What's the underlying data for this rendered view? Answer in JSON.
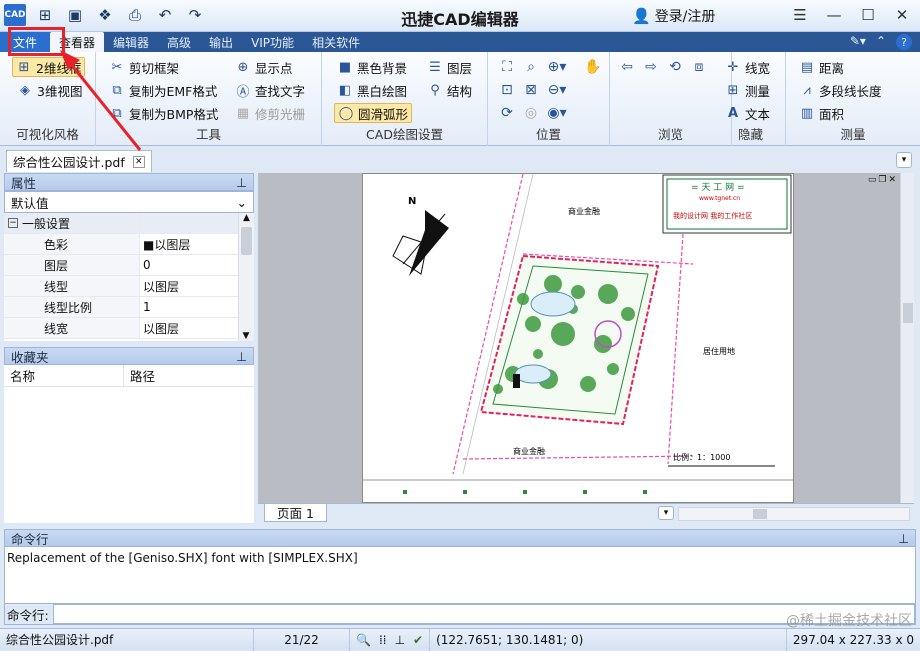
{
  "app": {
    "title": "迅捷CAD编辑器",
    "login": "登录/注册",
    "logo": "CAD"
  },
  "menu_tabs": [
    "文件",
    "查看器",
    "编辑器",
    "高级",
    "输出",
    "VIP功能",
    "相关软件"
  ],
  "ribbon": {
    "visual_style": {
      "label": "可视化风格",
      "btn_2d": "2维线框",
      "btn_3d": "3维视图"
    },
    "tools": {
      "label": "工具",
      "clip_frame": "剪切框架",
      "copy_emf": "复制为EMF格式",
      "copy_bmp": "复制为BMP格式",
      "show_point": "显示点",
      "find_text": "查找文字",
      "trim_raster": "修剪光栅"
    },
    "cad_settings": {
      "label": "CAD绘图设置",
      "black_bg": "黑色背景",
      "bw_draw": "黑白绘图",
      "smooth_arc": "圆滑弧形",
      "layers": "图层",
      "structure": "结构"
    },
    "position": {
      "label": "位置"
    },
    "browse": {
      "label": "浏览"
    },
    "hide": {
      "label": "隐藏",
      "line_width": "线宽",
      "measure": "测量",
      "text": "文本"
    },
    "measure": {
      "label": "测量",
      "distance": "距离",
      "polyline_length": "多段线长度",
      "area": "面积"
    }
  },
  "document_tab": "综合性公园设计.pdf",
  "properties": {
    "title": "属性",
    "selector": "默认值",
    "group": "一般设置",
    "rows": [
      {
        "key": "色彩",
        "value": "■以图层"
      },
      {
        "key": "图层",
        "value": "0"
      },
      {
        "key": "线型",
        "value": "以图层"
      },
      {
        "key": "线型比例",
        "value": "1"
      },
      {
        "key": "线宽",
        "value": "以图层"
      }
    ]
  },
  "favorites": {
    "title": "收藏夹",
    "col_name": "名称",
    "col_path": "路径"
  },
  "drawing": {
    "north": "N",
    "commercial": "商业金融",
    "residential": "居住用地",
    "scale": "比例：1：1000",
    "logo_line1": "= 天 工 网 =",
    "logo_line2": "www.tgnet.cn",
    "logo_line3": "我的设计网 我的工作社区"
  },
  "page_tab": "页面 1",
  "command": {
    "title": "命令行",
    "log": "Replacement of the [Geniso.SHX] font with [SIMPLEX.SHX]",
    "prompt": "命令行:",
    "input_value": ""
  },
  "status": {
    "file": "综合性公园设计.pdf",
    "page": "21/22",
    "coords": "(122.7651; 130.1481; 0)",
    "size": "297.04 x 227.33 x 0"
  },
  "watermark": "@稀土掘金技术社区",
  "colors": {
    "annotation_red": "#e8222a",
    "menubar": "#2b5797"
  }
}
